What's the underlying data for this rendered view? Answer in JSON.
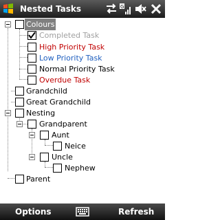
{
  "window": {
    "title": "Nested Tasks"
  },
  "status_icons": [
    "connectivity-icon",
    "signal-icon",
    "volume-icon",
    "close-icon"
  ],
  "colors": {
    "high": "#c00000",
    "low": "#1f5fbf",
    "completed": "#a0a0a0",
    "overdue": "#c00000",
    "selection": "#808080"
  },
  "tree": {
    "colours": "Colours",
    "completed_task": "Completed Task",
    "high_priority_task": "High Priority Task",
    "low_priority_task": "Low Priority Task",
    "normal_priority_task": "Normal Priority Task",
    "overdue_task": "Overdue Task",
    "grandchild": "Grandchild",
    "great_grandchild": "Great Grandchild",
    "nesting": "Nesting",
    "grandparent": "Grandparent",
    "aunt": "Aunt",
    "neice": "Neice",
    "uncle": "Uncle",
    "nephew": "Nephew",
    "parent": "Parent"
  },
  "softkeys": {
    "left": "Options",
    "right": "Refresh",
    "keyboard_icon": "keyboard-icon"
  }
}
